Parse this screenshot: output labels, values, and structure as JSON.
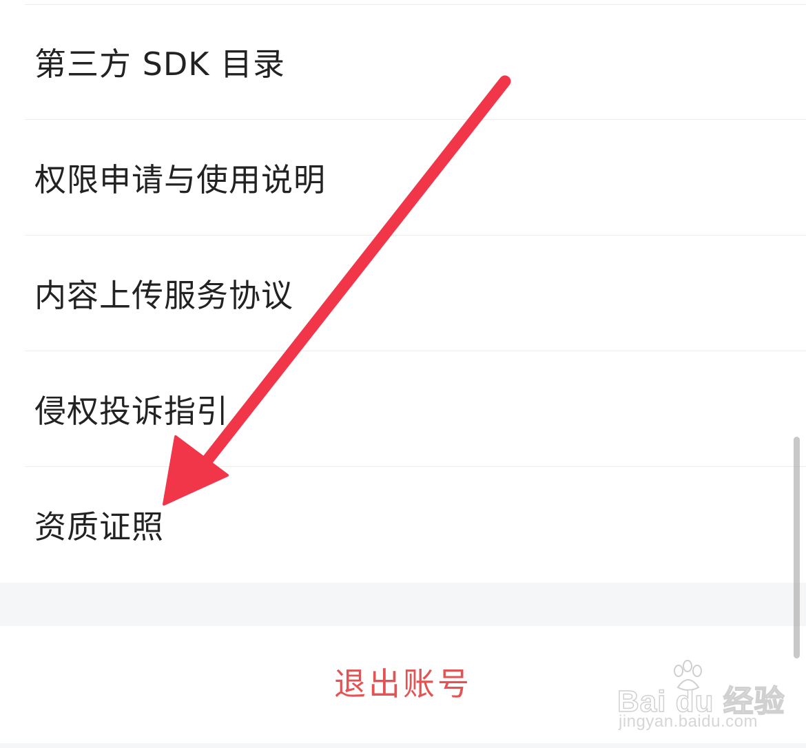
{
  "menu": {
    "items": [
      {
        "label": "第三方 SDK 目录"
      },
      {
        "label": "权限申请与使用说明"
      },
      {
        "label": "内容上传服务协议"
      },
      {
        "label": "侵权投诉指引"
      },
      {
        "label": "资质证照"
      }
    ]
  },
  "logout": {
    "label": "退出账号"
  },
  "annotation": {
    "arrow_color": "#f2364a",
    "points_to": "资质证照"
  },
  "watermark": {
    "brand": "Bai du 经验",
    "url": "jingyan.baidu.com"
  },
  "colors": {
    "menu_text": "#222222",
    "logout_text": "#e35353",
    "section_gap": "#f5f6f8",
    "divider": "#ececec"
  }
}
